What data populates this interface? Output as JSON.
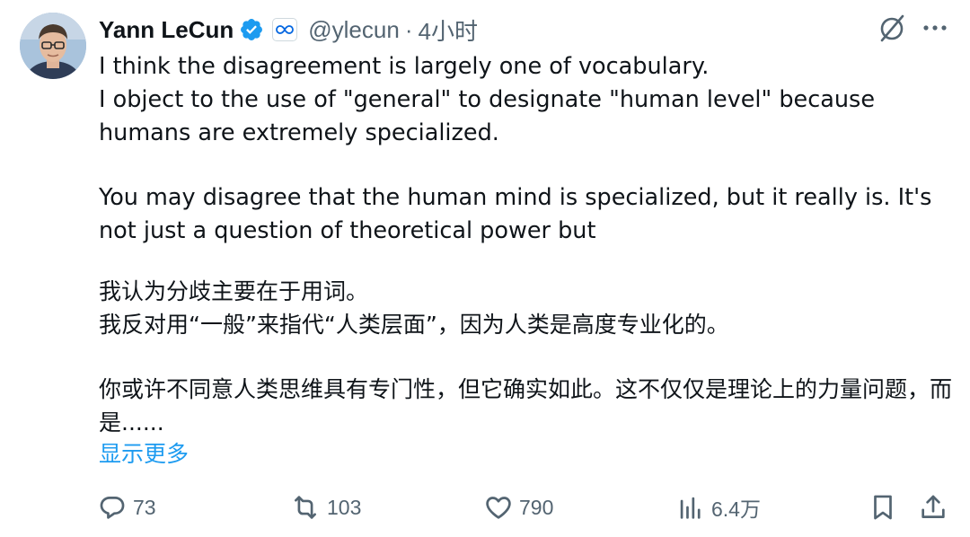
{
  "author": {
    "name": "Yann LeCun",
    "verified_icon": "verified-badge-icon",
    "affiliation_icon": "meta-infinity-icon",
    "handle": "@ylecun",
    "separator": "·",
    "time": "4小时"
  },
  "header_actions": {
    "grok_icon": "grok-slash-icon",
    "more_icon": "more-dots-icon"
  },
  "post": {
    "en_p1": "I think the disagreement is largely one of vocabulary.\nI object to the use of \"general\" to designate \"human level\" because humans are extremely specialized.",
    "en_p2": "You may disagree that the human mind is specialized, but it really is. It's not just a question of theoretical power but",
    "zh_p1": "我认为分歧主要在于用词。\n我反对用“一般”来指代“人类层面”，因为人类是高度专业化的。",
    "zh_p2": "你或许不同意人类思维具有专门性，但它确实如此。这不仅仅是理论上的力量问题，而是......",
    "show_more": "显示更多"
  },
  "actions": {
    "replies": "73",
    "reposts": "103",
    "likes": "790",
    "views": "6.4万"
  },
  "colors": {
    "text": "#0f1419",
    "secondary": "#536471",
    "link": "#1d9bf0",
    "verified": "#1d9bf0"
  }
}
